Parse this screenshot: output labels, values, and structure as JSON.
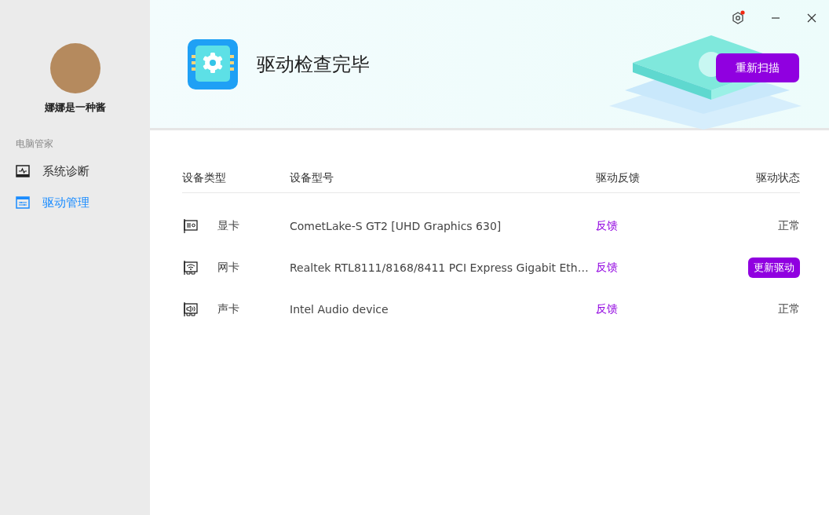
{
  "sidebar": {
    "user_name": "娜娜是一种酱",
    "section_title": "电脑管家",
    "items": [
      {
        "label": "系统诊断",
        "selected": false
      },
      {
        "label": "驱动管理",
        "selected": true
      }
    ]
  },
  "header": {
    "title": "驱动检查完毕",
    "rescan_button": "重新扫描",
    "settings_badge": true
  },
  "table": {
    "columns": [
      "设备类型",
      "设备型号",
      "驱动反馈",
      "驱动状态"
    ],
    "rows": [
      {
        "type": "显卡",
        "model": "CometLake-S GT2 [UHD Graphics 630]",
        "feedback": "反馈",
        "status": {
          "kind": "text",
          "label": "正常"
        }
      },
      {
        "type": "网卡",
        "model": "Realtek RTL8111/8168/8411 PCI Express Gigabit Eth…",
        "feedback": "反馈",
        "status": {
          "kind": "button",
          "label": "更新驱动"
        }
      },
      {
        "type": "声卡",
        "model": "Intel Audio device",
        "feedback": "反馈",
        "status": {
          "kind": "text",
          "label": "正常"
        }
      }
    ]
  }
}
